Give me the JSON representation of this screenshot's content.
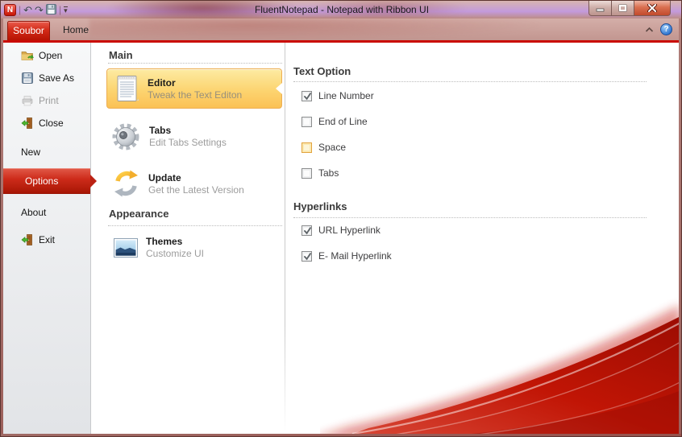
{
  "titlebar": {
    "title": "FluentNotepad - Notepad with Ribbon UI",
    "app_initial": "N",
    "icons": {
      "undo": "↶",
      "redo": "↷",
      "separator": "|",
      "dropdown": "▾"
    }
  },
  "tabs": {
    "file": "Soubor",
    "home": "Home"
  },
  "ribbon_right": {
    "help": "?"
  },
  "menu": {
    "open": "Open",
    "save_as": "Save As",
    "print": "Print",
    "close": "Close",
    "new": "New",
    "options": "Options",
    "about": "About",
    "exit": "Exit"
  },
  "sections": {
    "main": {
      "title": "Main",
      "editor": {
        "title": "Editor",
        "subtitle": "Tweak the Text Editon",
        "selected": true
      },
      "tabs": {
        "title": "Tabs",
        "subtitle": "Edit Tabs Settings"
      },
      "update": {
        "title": "Update",
        "subtitle": "Get the Latest Version"
      }
    },
    "appearance": {
      "title": "Appearance",
      "themes": {
        "title": "Themes",
        "subtitle": "Customize UI"
      }
    }
  },
  "panel": {
    "text_option": {
      "title": "Text Option",
      "line_number": {
        "label": "Line Number",
        "checked": true
      },
      "end_of_line": {
        "label": "End of Line",
        "checked": false
      },
      "space": {
        "label": "Space",
        "checked": false,
        "highlighted": true
      },
      "tabs": {
        "label": "Tabs",
        "checked": false
      }
    },
    "hyperlinks": {
      "title": "Hyperlinks",
      "url": {
        "label": "URL Hyperlink",
        "checked": true
      },
      "email": {
        "label": "E- Mail Hyperlink",
        "checked": true
      }
    }
  },
  "colors": {
    "accent_red_line": "#ca0b02",
    "file_tab_red": "#d22b18",
    "options_selected_red": "#cd2b1a",
    "editor_selected_orange": "#fbc155",
    "space_highlight_orange": "#e2a33d"
  }
}
